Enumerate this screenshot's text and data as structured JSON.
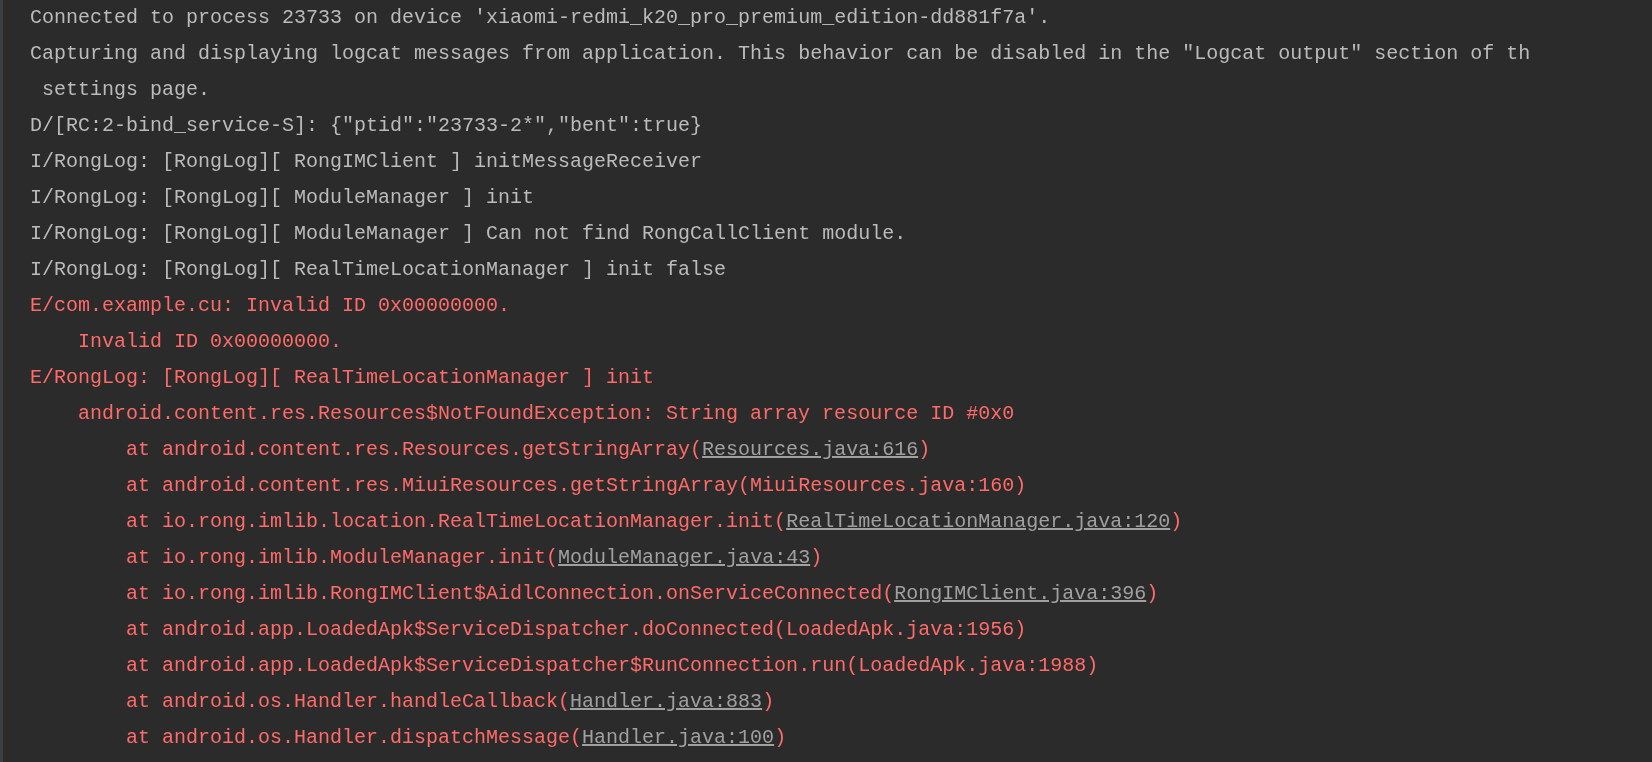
{
  "console": {
    "lines": [
      {
        "kind": "message",
        "color": "#bbbbbb",
        "text": "Connected to process 23733 on device 'xiaomi-redmi_k20_pro_premium_edition-dd881f7a'."
      },
      {
        "kind": "message",
        "color": "#bbbbbb",
        "text": "Capturing and displaying logcat messages from application. This behavior can be disabled in the \"Logcat output\" section of th"
      },
      {
        "kind": "continuation",
        "color": "#bbbbbb",
        "text": "settings page."
      },
      {
        "kind": "message",
        "color": "#bbbbbb",
        "text": "D/[RC:2-bind_service-S]: {\"ptid\":\"23733-2*\",\"bent\":true}"
      },
      {
        "kind": "message",
        "color": "#bbbbbb",
        "text": "I/RongLog: [RongLog][ RongIMClient ] initMessageReceiver"
      },
      {
        "kind": "message",
        "color": "#bbbbbb",
        "text": "I/RongLog: [RongLog][ ModuleManager ] init"
      },
      {
        "kind": "message",
        "color": "#bbbbbb",
        "text": "I/RongLog: [RongLog][ ModuleManager ] Can not find RongCallClient module."
      },
      {
        "kind": "message",
        "color": "#bbbbbb",
        "text": "I/RongLog: [RongLog][ RealTimeLocationManager ] init false"
      },
      {
        "kind": "message",
        "color": "#ff6b68",
        "text": "E/com.example.cu: Invalid ID 0x00000000."
      },
      {
        "kind": "cause",
        "color": "#ff6b68",
        "text": "Invalid ID 0x00000000."
      },
      {
        "kind": "message",
        "color": "#ff6b68",
        "text": "E/RongLog: [RongLog][ RealTimeLocationManager ] init"
      },
      {
        "kind": "cause",
        "color": "#ff6b68",
        "text": "android.content.res.Resources$NotFoundException: String array resource ID #0x0"
      },
      {
        "kind": "frame",
        "color": "#ff6b68",
        "text": "at android.content.res.Resources.getStringArray(",
        "link": "Resources.java:616",
        "suffix": ")"
      },
      {
        "kind": "frame",
        "color": "#ff6b68",
        "text": "at android.content.res.MiuiResources.getStringArray(MiuiResources.java:160)"
      },
      {
        "kind": "frame",
        "color": "#ff6b68",
        "text": "at io.rong.imlib.location.RealTimeLocationManager.init(",
        "link": "RealTimeLocationManager.java:120",
        "suffix": ")"
      },
      {
        "kind": "frame",
        "color": "#ff6b68",
        "text": "at io.rong.imlib.ModuleManager.init(",
        "link": "ModuleManager.java:43",
        "suffix": ")"
      },
      {
        "kind": "frame",
        "color": "#ff6b68",
        "text": "at io.rong.imlib.RongIMClient$AidlConnection.onServiceConnected(",
        "link": "RongIMClient.java:396",
        "suffix": ")"
      },
      {
        "kind": "frame",
        "color": "#ff6b68",
        "text": "at android.app.LoadedApk$ServiceDispatcher.doConnected(LoadedApk.java:1956)"
      },
      {
        "kind": "frame",
        "color": "#ff6b68",
        "text": "at android.app.LoadedApk$ServiceDispatcher$RunConnection.run(LoadedApk.java:1988)"
      },
      {
        "kind": "frame",
        "color": "#ff6b68",
        "text": "at android.os.Handler.handleCallback(",
        "link": "Handler.java:883",
        "suffix": ")"
      },
      {
        "kind": "frame",
        "color": "#ff6b68",
        "text": "at android.os.Handler.dispatchMessage(",
        "link": "Handler.java:100",
        "suffix": ")"
      }
    ]
  }
}
